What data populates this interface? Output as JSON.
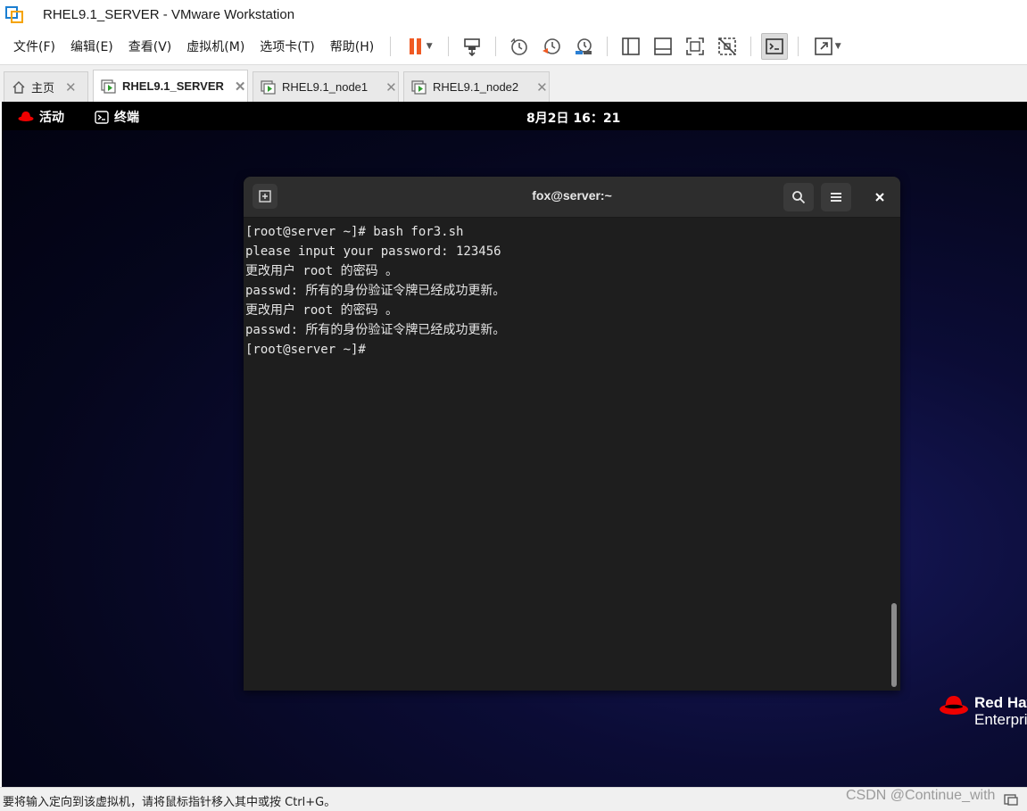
{
  "window": {
    "title": "RHEL9.1_SERVER - VMware Workstation",
    "app_icon": "vmware-workstation-icon"
  },
  "menu": {
    "items": [
      "文件(F)",
      "编辑(E)",
      "查看(V)",
      "虚拟机(M)",
      "选项卡(T)",
      "帮助(H)"
    ]
  },
  "toolbar": {
    "icons": [
      "pause-icon",
      "send-ctrl-alt-del-icon",
      "snapshot-icon",
      "revert-snapshot-icon",
      "snapshot-manager-icon",
      "show-library-icon",
      "thumbnail-bar-icon",
      "full-screen-icon",
      "unity-icon",
      "console-view-icon",
      "stretch-guest-icon"
    ],
    "accent_color": "#f05a23"
  },
  "tabs": [
    {
      "label": "主页",
      "icon": "home-icon",
      "active": false
    },
    {
      "label": "RHEL9.1_SERVER",
      "icon": "vm-running-icon",
      "active": true
    },
    {
      "label": "RHEL9.1_node1",
      "icon": "vm-running-icon",
      "active": false
    },
    {
      "label": "RHEL9.1_node2",
      "icon": "vm-running-icon",
      "active": false
    }
  ],
  "guest": {
    "top_bar": {
      "activities": "活动",
      "app_name": "终端",
      "clock": "8月2日  16：21"
    },
    "terminal": {
      "title": "fox@server:~",
      "lines": [
        "[root@server ~]# bash for3.sh",
        "please input your password: 123456",
        "更改用户 root 的密码 。",
        "passwd: 所有的身份验证令牌已经成功更新。",
        "更改用户 root 的密码 。",
        "passwd: 所有的身份验证令牌已经成功更新。",
        "[root@server ~]#"
      ]
    },
    "branding": {
      "line1": "Red Hat",
      "line2": "Enterprise",
      "logo_color": "#ee0000"
    }
  },
  "statusbar": {
    "text": "要将输入定向到该虚拟机，请将鼠标指针移入其中或按 Ctrl+G。",
    "watermark": "CSDN @Continue_with"
  }
}
